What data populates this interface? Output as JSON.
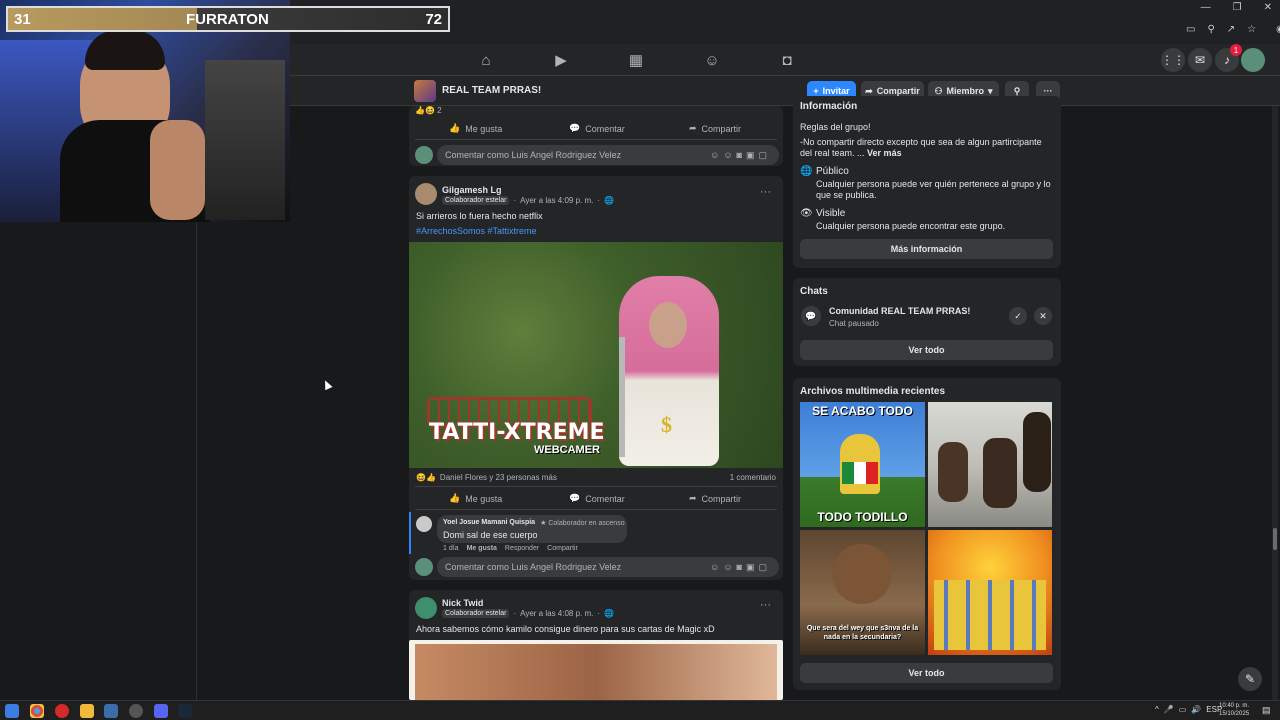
{
  "stream": {
    "score_left": "31",
    "title": "FURRATON",
    "score_right": "72"
  },
  "header": {
    "group_name": "REAL TEAM PRRAS!",
    "invite_label": "Invitar",
    "share_label": "Compartir",
    "member_label": "Miembro",
    "notif_count": "1"
  },
  "top_post": {
    "like_label": "Me gusta",
    "comment_label": "Comentar",
    "share_label": "Compartir",
    "comment_placeholder": "Comentar como Luis Angel Rodriguez Velez"
  },
  "post1": {
    "author": "Gilgamesh Lg",
    "badge": "Colaborador estelar",
    "time": "Ayer a las 4:09 p. m.",
    "text": "Si arrieros lo fuera hecho netflix",
    "hashtags": "#ArrechosSomos #Tattixtreme",
    "image_text": "TATTI-XTREME",
    "image_subtext": "WEBCAMER",
    "reactions": "Daniel Flores y 23 personas más",
    "comments_count": "1 comentario",
    "like_label": "Me gusta",
    "comment_label": "Comentar",
    "share_label": "Compartir",
    "comment": {
      "author": "Yoel Josue Mamani Quispia",
      "badge": "Colaborador en ascenso",
      "text": "Domi sal de ese cuerpo",
      "time": "1 día",
      "like": "Me gusta",
      "reply": "Responder",
      "share": "Compartir"
    },
    "comment_placeholder": "Comentar como Luis Angel Rodriguez Velez"
  },
  "post2": {
    "author": "Nick Twid",
    "badge": "Colaborador estelar",
    "time": "Ayer a las 4:08 p. m.",
    "text": "Ahora sabemos cómo kamilo consigue dinero para sus cartas de Magic xD"
  },
  "info": {
    "heading": "Información",
    "rules_title": "Reglas del grupo!",
    "rules_text": "-No compartir directo excepto que sea de algun partircipante del real team. ...",
    "see_more": "Ver más",
    "public_title": "Público",
    "public_desc": "Cualquier persona puede ver quién pertenece al grupo y lo que se publica.",
    "visible_title": "Visible",
    "visible_desc": "Cualquier persona puede encontrar este grupo.",
    "more_info_button": "Más información"
  },
  "chats": {
    "heading": "Chats",
    "chat_name": "Comunidad REAL TEAM PRRAS!",
    "chat_status": "Chat pausado",
    "see_all": "Ver todo"
  },
  "media": {
    "heading": "Archivos multimedia recientes",
    "thumb1_top": "SE ACABO TODO",
    "thumb1_bottom": "TODO TODILLO",
    "thumb3_text": "Que sera del wey que s3nva de la nada en la secundaria?",
    "see_all": "Ver todo"
  },
  "taskbar": {
    "lang": "ESP",
    "time": "10:40 p. m.",
    "date": "15/10/2025"
  },
  "colors": {
    "accent": "#2d88ff",
    "bg": "#18191a",
    "card": "#242526"
  }
}
